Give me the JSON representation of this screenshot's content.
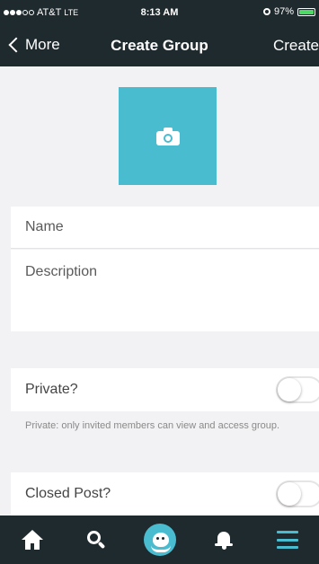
{
  "status_bar": {
    "carrier": "AT&T",
    "network": "LTE",
    "time": "8:13 AM",
    "battery_percent": "97%",
    "battery_level": 0.97,
    "signal_bars_filled": 3,
    "signal_bars_total": 5
  },
  "nav": {
    "back_label": "More",
    "title": "Create Group",
    "action_label": "Create"
  },
  "photo": {
    "icon": "camera-icon",
    "color": "#4abccf"
  },
  "form": {
    "name_placeholder": "Name",
    "name_value": "",
    "description_placeholder": "Description",
    "description_value": ""
  },
  "settings": {
    "private_label": "Private?",
    "private_on": false,
    "private_help": "Private: only invited members can view and access group.",
    "closed_post_label": "Closed Post?",
    "closed_post_on": false
  },
  "tab_bar": {
    "tabs": [
      {
        "icon": "home-icon"
      },
      {
        "icon": "search-icon"
      },
      {
        "icon": "mascot-icon"
      },
      {
        "icon": "bell-icon"
      },
      {
        "icon": "menu-icon"
      }
    ],
    "accent": "#4abccf"
  },
  "colors": {
    "nav_background": "#1f2a2e",
    "page_background": "#f2f2f4",
    "accent": "#4abccf"
  }
}
